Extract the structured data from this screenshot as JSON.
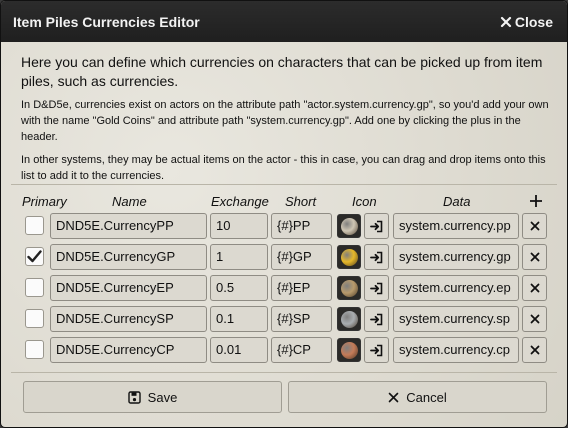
{
  "window": {
    "title": "Item Piles Currencies Editor",
    "close_label": "Close"
  },
  "intro": {
    "lead": "Here you can define which currencies on characters that can be picked up from item piles, such as currencies.",
    "p1": "In D&D5e, currencies exist on actors on the attribute path \"actor.system.currency.gp\", so you'd add your own with the name \"Gold Coins\" and attribute path \"system.currency.gp\". Add one by clicking the plus in the header.",
    "p2": "In other systems, they may be actual items on the actor - this in case, you can drag and drop items onto this list to add it to the currencies."
  },
  "table": {
    "headers": {
      "primary": "Primary",
      "name": "Name",
      "exchange": "Exchange",
      "short": "Short",
      "icon": "Icon",
      "data": "Data"
    },
    "rows": [
      {
        "primary": false,
        "name": "DND5E.CurrencyPP",
        "exchange": "10",
        "short": "{#}PP",
        "data": "system.currency.pp",
        "coin_color": "#cfc6b4"
      },
      {
        "primary": true,
        "name": "DND5E.CurrencyGP",
        "exchange": "1",
        "short": "{#}GP",
        "data": "system.currency.gp",
        "coin_color": "#e6b82a"
      },
      {
        "primary": false,
        "name": "DND5E.CurrencyEP",
        "exchange": "0.5",
        "short": "{#}EP",
        "data": "system.currency.ep",
        "coin_color": "#b89a6c"
      },
      {
        "primary": false,
        "name": "DND5E.CurrencySP",
        "exchange": "0.1",
        "short": "{#}SP",
        "data": "system.currency.sp",
        "coin_color": "#a9adb0"
      },
      {
        "primary": false,
        "name": "DND5E.CurrencyCP",
        "exchange": "0.01",
        "short": "{#}CP",
        "data": "system.currency.cp",
        "coin_color": "#c47b58"
      }
    ]
  },
  "footer": {
    "save_label": "Save",
    "cancel_label": "Cancel"
  },
  "icons": {
    "close": "close-icon",
    "add": "plus-icon",
    "import": "sign-in-icon",
    "delete": "x-icon",
    "save": "floppy-disk-icon",
    "cancel": "x-icon"
  }
}
